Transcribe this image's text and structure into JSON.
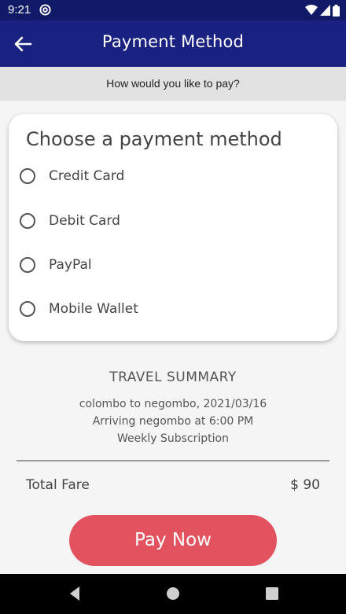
{
  "status_bar": {
    "time": "9:21",
    "app_icon": "at-circle-icon",
    "wifi_icon": "wifi-icon",
    "signal_icon": "signal-icon",
    "battery_icon": "battery-icon"
  },
  "app_bar": {
    "title": "Payment Method",
    "back_icon": "back-arrow-icon",
    "background": "#1a2281"
  },
  "subheader": {
    "text": "How would you like to pay?"
  },
  "payment_card": {
    "title": "Choose a payment method",
    "options": [
      {
        "label": "Credit Card",
        "selected": false
      },
      {
        "label": "Debit Card",
        "selected": false
      },
      {
        "label": "PayPal",
        "selected": false
      },
      {
        "label": "Mobile Wallet",
        "selected": false
      }
    ]
  },
  "summary": {
    "title": "TRAVEL SUMMARY",
    "lines": [
      "colombo to negombo, 2021/03/16",
      "Arriving negombo at 6:00 PM",
      "Weekly Subscription"
    ],
    "total_label": "Total Fare",
    "total_value": "$ 90"
  },
  "pay_button": {
    "label": "Pay Now",
    "color": "#e2525f"
  },
  "nav_bar": {
    "back_icon": "nav-back-icon",
    "home_icon": "nav-home-icon",
    "recents_icon": "nav-recents-icon"
  }
}
